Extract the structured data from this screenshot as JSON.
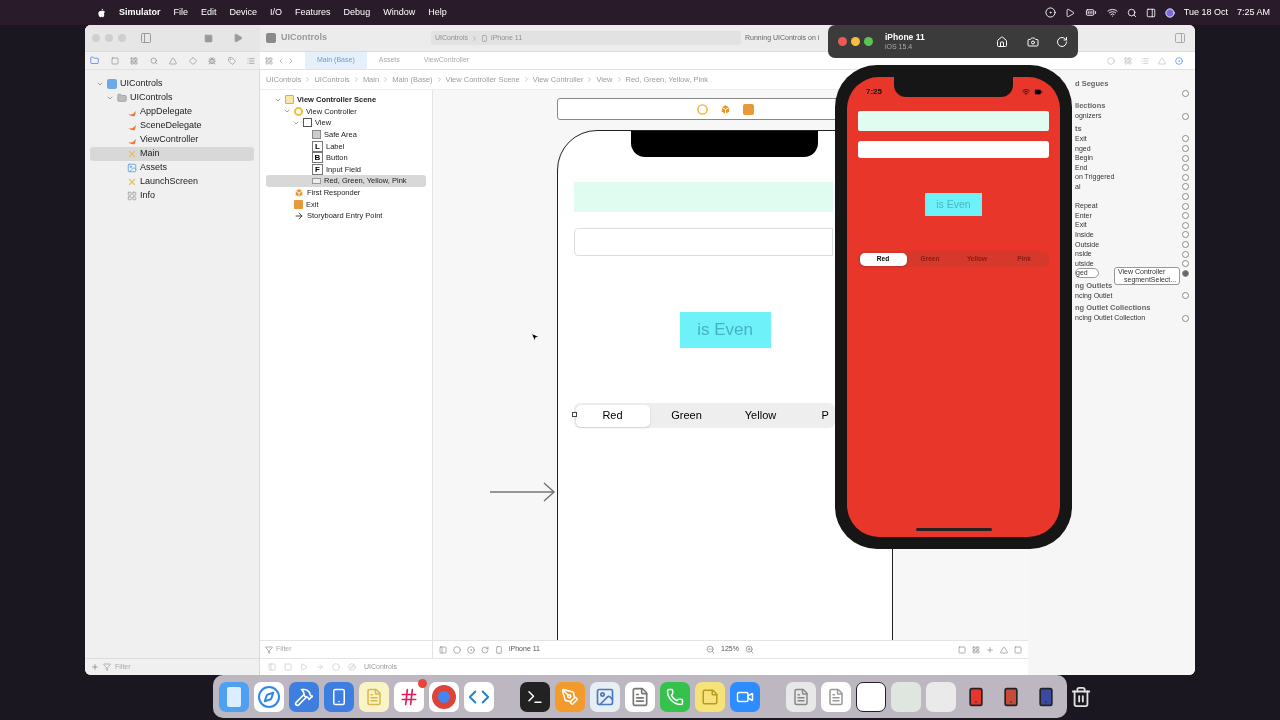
{
  "menubar": {
    "app": "Simulator",
    "menus": [
      "File",
      "Edit",
      "Device",
      "I/O",
      "Features",
      "Debug",
      "Window",
      "Help"
    ],
    "date": "Tue 18 Oct",
    "time": "7:25 AM"
  },
  "xcode": {
    "title": "UIControls",
    "scheme": "UIControls",
    "destination": "iPhone 11",
    "status": "Running UIControls on i",
    "tabs": [
      {
        "label": "Main (Base)",
        "selected": true
      },
      {
        "label": "Assets",
        "selected": false
      },
      {
        "label": "ViewController",
        "selected": false
      }
    ],
    "breadcrumb": [
      "UIControls",
      "UIControls",
      "Main",
      "Main (Base)",
      "View Controller Scene",
      "View Controller",
      "View",
      "Red, Green, Yellow, Pink"
    ],
    "navigator": [
      {
        "label": "UIControls",
        "kind": "project",
        "expanded": true,
        "selected": false,
        "children": [
          {
            "label": "UIControls",
            "kind": "folder",
            "expanded": true,
            "selected": false,
            "children": [
              {
                "label": "AppDelegate",
                "kind": "swift",
                "selected": false
              },
              {
                "label": "SceneDelegate",
                "kind": "swift",
                "selected": false
              },
              {
                "label": "ViewController",
                "kind": "swift",
                "selected": false
              },
              {
                "label": "Main",
                "kind": "storyboard",
                "selected": true
              },
              {
                "label": "Assets",
                "kind": "assets",
                "selected": false
              },
              {
                "label": "LaunchScreen",
                "kind": "storyboard",
                "selected": false
              },
              {
                "label": "Info",
                "kind": "plist",
                "selected": false
              }
            ]
          }
        ]
      }
    ],
    "navigator_filter": {
      "placeholder": "Filter"
    },
    "outline": [
      {
        "label": "View Controller Scene",
        "kind": "scene",
        "expanded": true,
        "selected": false,
        "children": [
          {
            "label": "View Controller",
            "kind": "controller",
            "expanded": true,
            "selected": false,
            "children": [
              {
                "label": "View",
                "kind": "view",
                "expanded": true,
                "selected": false,
                "children": [
                  {
                    "label": "Safe Area",
                    "kind": "safe-area",
                    "selected": false
                  },
                  {
                    "label": "Label",
                    "kind": "glyph",
                    "glyph": "L",
                    "selected": false
                  },
                  {
                    "label": "Button",
                    "kind": "glyph",
                    "glyph": "B",
                    "selected": false
                  },
                  {
                    "label": "Input Field",
                    "kind": "glyph",
                    "glyph": "F",
                    "selected": false
                  },
                  {
                    "label": "Red, Green, Yellow, Pink",
                    "kind": "segmented",
                    "selected": true
                  }
                ]
              }
            ]
          },
          {
            "label": "First Responder",
            "kind": "responder",
            "selected": false
          },
          {
            "label": "Exit",
            "kind": "exit",
            "selected": false
          },
          {
            "label": "Storyboard Entry Point",
            "kind": "entry",
            "selected": false
          }
        ]
      }
    ],
    "outline_filter": {
      "placeholder": "Filter"
    },
    "storyboard": {
      "button": "is Even",
      "segments": [
        {
          "label": "Red",
          "selected": true
        },
        {
          "label": "Green",
          "selected": false
        },
        {
          "label": "Yellow",
          "selected": false
        },
        {
          "label": "P",
          "selected": false
        }
      ]
    },
    "canvas_bar": {
      "device": "iPhone 11",
      "zoom": "125%"
    },
    "debug_bar": {
      "target": "UIControls"
    },
    "inspector": [
      {
        "kind": "header",
        "label": "d Segues"
      },
      {
        "kind": "row",
        "connected": false
      },
      {
        "kind": "header",
        "label": "llections"
      },
      {
        "kind": "row",
        "label": "ognizers",
        "connected": false
      },
      {
        "kind": "header",
        "label": "ts"
      },
      {
        "kind": "row",
        "label": "Exit",
        "connected": false
      },
      {
        "kind": "row",
        "label": "nged",
        "connected": false
      },
      {
        "kind": "row",
        "label": "Begin",
        "connected": false
      },
      {
        "kind": "row",
        "label": "End",
        "connected": false
      },
      {
        "kind": "row",
        "label": "on Triggered",
        "connected": false
      },
      {
        "kind": "row",
        "label": "al",
        "connected": false
      },
      {
        "kind": "row",
        "connected": false
      },
      {
        "kind": "row",
        "label": "Repeat",
        "connected": false
      },
      {
        "kind": "row",
        "label": "Enter",
        "connected": false
      },
      {
        "kind": "row",
        "label": "Exit",
        "connected": false
      },
      {
        "kind": "row",
        "label": "Inside",
        "connected": false
      },
      {
        "kind": "row",
        "label": "Outside",
        "connected": false
      },
      {
        "kind": "row",
        "label": "nside",
        "connected": false
      },
      {
        "kind": "row",
        "label": "utside",
        "connected": false
      },
      {
        "kind": "row",
        "label": "ged",
        "connected": true,
        "target": "View Controller",
        "action": "segmentSelect..."
      },
      {
        "kind": "header",
        "label": "ng Outlets"
      },
      {
        "kind": "row",
        "label": "ncing Outlet",
        "connected": false
      },
      {
        "kind": "header",
        "label": "ng Outlet Collections"
      },
      {
        "kind": "row",
        "label": "ncing Outlet Collection",
        "connected": false
      }
    ]
  },
  "simulator": {
    "device": "iPhone 11",
    "os": "iOS 15.4",
    "time": "7:25",
    "button": "is Even",
    "segments": [
      {
        "label": "Red",
        "selected": true
      },
      {
        "label": "Green",
        "selected": false
      },
      {
        "label": "Yellow",
        "selected": false
      },
      {
        "label": "Pink",
        "selected": false
      }
    ]
  }
}
